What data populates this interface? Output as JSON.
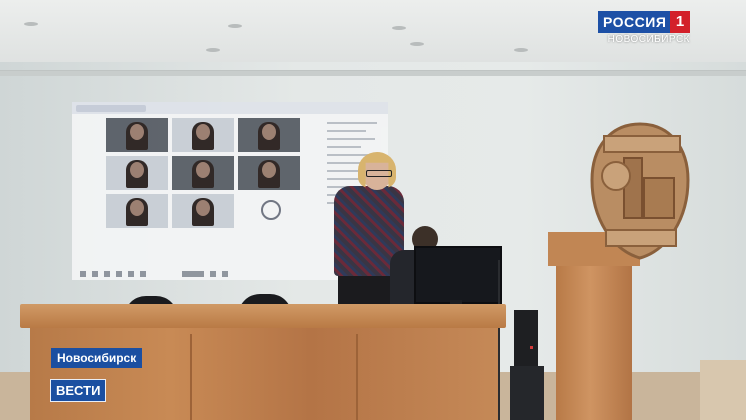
{
  "overlay": {
    "channel_name": "РОССИЯ",
    "channel_number": "1",
    "channel_city": "НОВОСИБИРСК",
    "location": "Новосибирск",
    "program": "ВЕСТИ"
  },
  "colors": {
    "overlay_blue": "#1b4fa1",
    "logo_red": "#d3202a",
    "wood": "#c08550",
    "wall": "#e2e6e5"
  }
}
